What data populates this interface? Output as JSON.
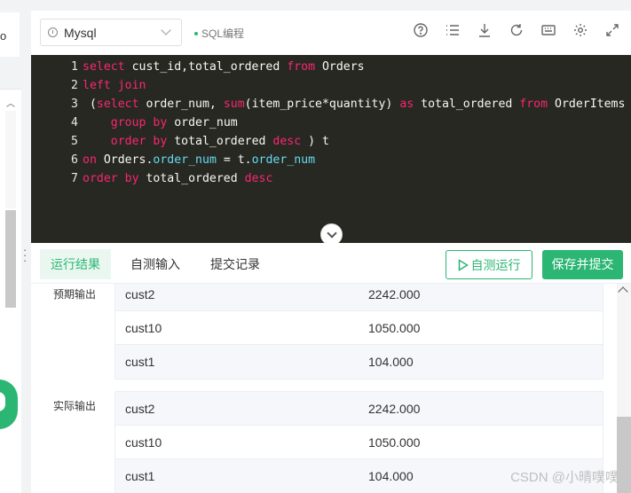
{
  "left_panel": {
    "partial_char": "o"
  },
  "toolbar": {
    "language": "Mysql",
    "mode_label": "SQL编程",
    "icons": [
      "help-icon",
      "list-icon",
      "download-icon",
      "refresh-icon",
      "keyboard-icon",
      "gear-icon",
      "fullscreen-icon"
    ]
  },
  "editor": {
    "lines": [
      {
        "no": "1",
        "tokens": [
          [
            "kw",
            "select"
          ],
          [
            "t",
            " cust_id,total_ordered "
          ],
          [
            "kw",
            "from"
          ],
          [
            "t",
            " Orders"
          ]
        ]
      },
      {
        "no": "2",
        "tokens": [
          [
            "kw",
            "left join"
          ]
        ]
      },
      {
        "no": "3",
        "tokens": [
          [
            "t",
            " ("
          ],
          [
            "kw",
            "select"
          ],
          [
            "t",
            " order_num, "
          ],
          [
            "kw",
            "sum"
          ],
          [
            "t",
            "(item_price*quantity) "
          ],
          [
            "kw",
            "as"
          ],
          [
            "t",
            " total_ordered "
          ],
          [
            "kw",
            "from"
          ],
          [
            "t",
            " OrderItems"
          ]
        ]
      },
      {
        "no": "4",
        "tokens": [
          [
            "t",
            "    "
          ],
          [
            "kw",
            "group by"
          ],
          [
            "t",
            " order_num"
          ]
        ]
      },
      {
        "no": "5",
        "tokens": [
          [
            "t",
            "    "
          ],
          [
            "kw",
            "order by"
          ],
          [
            "t",
            " total_ordered "
          ],
          [
            "kw",
            "desc"
          ],
          [
            "t",
            " ) t"
          ]
        ]
      },
      {
        "no": "6",
        "tokens": [
          [
            "kw",
            "on"
          ],
          [
            "t",
            " Orders."
          ],
          [
            "fn",
            "order_num"
          ],
          [
            "t",
            " = t."
          ],
          [
            "fn",
            "order_num"
          ]
        ]
      },
      {
        "no": "7",
        "tokens": [
          [
            "kw",
            "order by"
          ],
          [
            "t",
            " total_ordered "
          ],
          [
            "kw",
            "desc"
          ]
        ]
      }
    ]
  },
  "tabs": [
    {
      "label": "运行结果",
      "active": true
    },
    {
      "label": "自测输入",
      "active": false
    },
    {
      "label": "提交记录",
      "active": false
    }
  ],
  "actions": {
    "run_label": "自测运行",
    "submit_label": "保存并提交"
  },
  "results": {
    "expected_label": "预期输出",
    "actual_label": "实际输出",
    "expected_rows": [
      [
        "cust2",
        "2242.000"
      ],
      [
        "cust10",
        "1050.000"
      ],
      [
        "cust1",
        "104.000"
      ]
    ],
    "actual_rows": [
      [
        "cust2",
        "2242.000"
      ],
      [
        "cust10",
        "1050.000"
      ],
      [
        "cust1",
        "104.000"
      ]
    ]
  },
  "watermark": "CSDN @小晴噗噗",
  "colors": {
    "accent": "#2bb673",
    "editor_bg": "#272822",
    "keyword": "#f92672",
    "property": "#66d9ef"
  }
}
